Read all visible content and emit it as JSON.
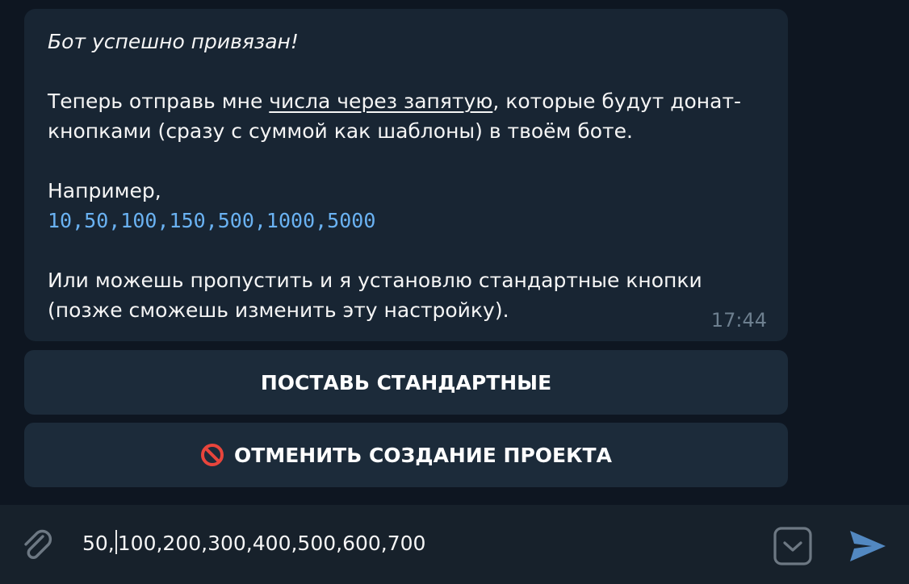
{
  "message": {
    "title": "Бот успешно привязан!",
    "line2_before": "Теперь отправь мне ",
    "line2_link": "числа через запятую",
    "line2_after": ", которые будут донат-",
    "line3": "кнопками (сразу с суммой как шаблоны) в твоём боте.",
    "example_label": "Например,",
    "example_code": "10,50,100,150,500,1000,5000",
    "skip_line1": "Или можешь пропустить и я установлю стандартные кнопки",
    "skip_line2": "(позже сможешь изменить эту настройку).",
    "time": "17:44"
  },
  "keyboard": {
    "standard_label": "ПОСТАВЬ СТАНДАРТНЫЕ",
    "cancel_label": "ОТМЕНИТЬ СОЗДАНИЕ ПРОЕКТА"
  },
  "composer": {
    "value_before_caret": "50,",
    "value_after_caret": "100,200,300,400,500,600,700"
  },
  "icons": {
    "attach": "paperclip-icon",
    "cancel": "no-entry-icon",
    "keyboard_toggle": "keyboard-toggle-icon",
    "send": "send-icon"
  },
  "colors": {
    "background": "#0e1621",
    "bubble": "#182533",
    "button": "#1c2b3a",
    "composer": "#17212b",
    "code": "#6ab2f2",
    "accent": "#5288c1",
    "time": "#6d7f8f"
  }
}
